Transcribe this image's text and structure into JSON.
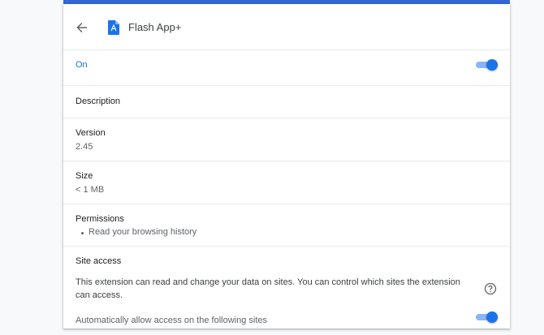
{
  "header": {
    "title": "Flash App+"
  },
  "enabled": {
    "label": "On",
    "state": true
  },
  "description": {
    "label": "Description"
  },
  "version": {
    "label": "Version",
    "value": "2.45"
  },
  "size": {
    "label": "Size",
    "value": "< 1 MB"
  },
  "permissions": {
    "label": "Permissions",
    "items": [
      "Read your browsing history"
    ]
  },
  "site_access": {
    "label": "Site access",
    "description": "This extension can read and change your data on sites. You can control which sites the extension can access.",
    "auto_allow_label": "Automatically allow access on the following sites",
    "auto_allow_state": true
  },
  "colors": {
    "accent": "#1a73e8",
    "toggle_track": "#8ab4f8",
    "top_bar": "#3367d6"
  },
  "icons": {
    "back": "arrow-back-icon",
    "app": "app-document-icon",
    "help": "help-circle-icon"
  }
}
